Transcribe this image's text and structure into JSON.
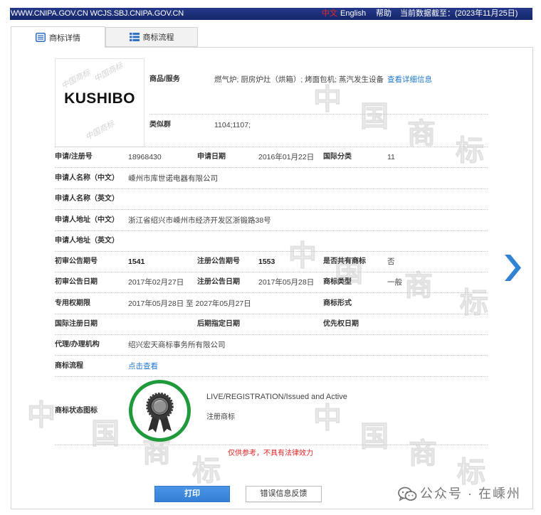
{
  "topbar": {
    "site": "WWW.CNIPA.GOV.CN WCJS.SBJ.CNIPA.GOV.CN",
    "lang_zh": "中文",
    "lang_en": "English",
    "help": "帮助",
    "data_as_of": "当前数据截至：(2023年11月25日)"
  },
  "tabs": {
    "detail": {
      "label": "商标详情",
      "icon": "document-icon",
      "active": true
    },
    "process": {
      "label": "商标流程",
      "icon": "list-icon",
      "active": false
    }
  },
  "trademark": {
    "logo_text": "KUSHIBO",
    "logo_watermark": "中国商标",
    "goods": {
      "label": "商品/服务",
      "value": "燃气炉; 厨房炉灶（烘箱）; 烤面包机; 蒸汽发生设备",
      "link": "查看详细信息"
    },
    "similar_group": {
      "label": "类似群",
      "value": "1104;1107;"
    }
  },
  "details": {
    "reg_no": {
      "label": "申请/注册号",
      "value": "18968430"
    },
    "app_date": {
      "label": "申请日期",
      "value": "2016年01月22日"
    },
    "intl_class": {
      "label": "国际分类",
      "value": "11"
    },
    "applicant_cn": {
      "label": "申请人名称（中文）",
      "value": "嵊州市库世诺电器有限公司"
    },
    "applicant_en": {
      "label": "申请人名称（英文）"
    },
    "address_cn": {
      "label": "申请人地址（中文）",
      "value": "浙江省绍兴市嵊州市经济开发区浙锻路38号"
    },
    "address_en": {
      "label": "申请人地址（英文）"
    },
    "prelim_issue_no": {
      "label": "初审公告期号",
      "value": "1541"
    },
    "reg_issue_no": {
      "label": "注册公告期号",
      "value": "1553"
    },
    "shared_mark": {
      "label": "是否共有商标",
      "value": "否"
    },
    "prelim_date": {
      "label": "初审公告日期",
      "value": "2017年02月27日"
    },
    "reg_date": {
      "label": "注册公告日期",
      "value": "2017年05月28日"
    },
    "mark_type": {
      "label": "商标类型",
      "value": "一般"
    },
    "exclusive_term": {
      "label": "专用权期限",
      "value": "2017年05月28日 至 2027年05月27日"
    },
    "mark_form": {
      "label": "商标形式"
    },
    "intl_reg_date": {
      "label": "国际注册日期"
    },
    "later_designation_date": {
      "label": "后期指定日期"
    },
    "priority_date": {
      "label": "优先权日期"
    },
    "agent": {
      "label": "代理/办理机构",
      "value": "绍兴宏天商标事务所有限公司"
    },
    "process": {
      "label": "商标流程",
      "link": "点击查看"
    }
  },
  "status": {
    "label": "商标状态图标",
    "icon": "registered-badge-icon",
    "status_en": "LIVE/REGISTRATION/Issued and Active",
    "status_cn": "注册商标"
  },
  "disclaimer": "仅供参考，不具有法律效力",
  "buttons": {
    "print": "打印",
    "feedback": "错误信息反馈"
  },
  "navigation": {
    "next_icon": "chevron-right-icon"
  },
  "watermark": {
    "text": "中国商标"
  },
  "overlay": {
    "icon": "wechat-icon",
    "text": "公众号 · 在嵊州"
  },
  "colors": {
    "topbar": "#1b2f79",
    "link_blue": "#1f78d1",
    "button_blue": "#3b8ae0",
    "status_green": "#1f9a3a",
    "disclaimer_red": "#e62222",
    "lang_active_red": "#e32626"
  }
}
